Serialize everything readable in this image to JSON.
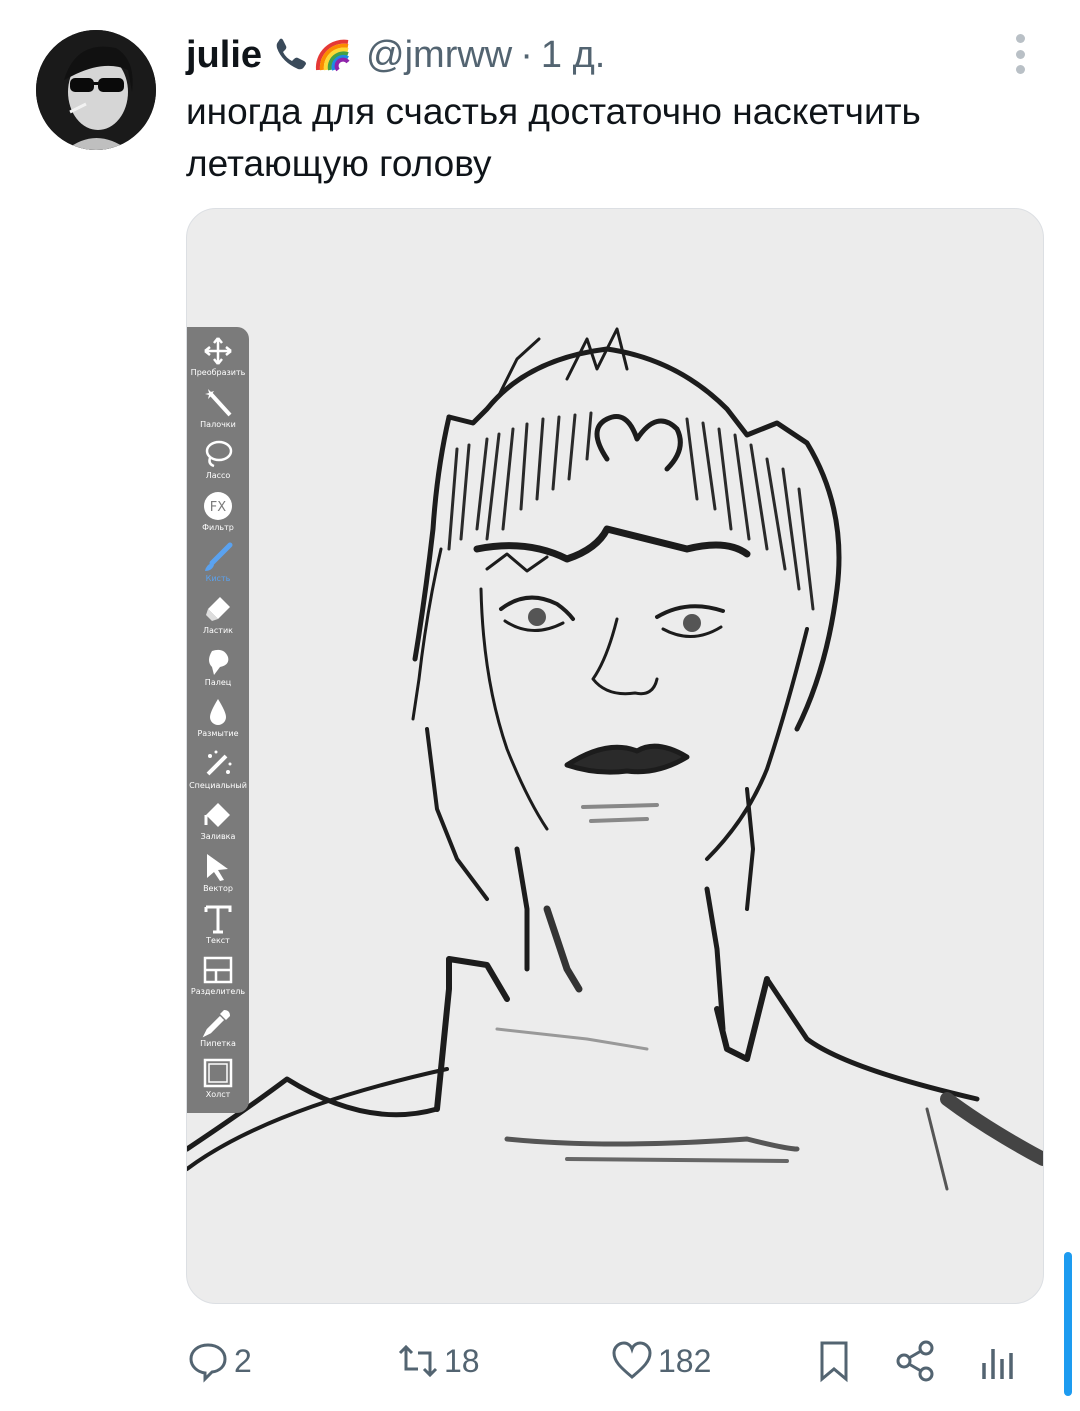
{
  "tweet": {
    "author_name": "julie",
    "author_emoji": [
      "telephone-receiver-icon",
      "rainbow-icon"
    ],
    "handle": "@jmrww",
    "separator": "·",
    "time": "1 д.",
    "text": "иногда для счастья достаточно наскетчить летающую голову"
  },
  "media": {
    "toolbar": [
      {
        "label": "Преобразить",
        "icon": "move-arrows-icon"
      },
      {
        "label": "Палочки",
        "icon": "magic-wand-icon"
      },
      {
        "label": "Лассо",
        "icon": "lasso-icon"
      },
      {
        "label": "Фильтр",
        "icon": "fx-filter-icon"
      },
      {
        "label": "Кисть",
        "icon": "brush-icon",
        "active": true
      },
      {
        "label": "Ластик",
        "icon": "eraser-icon"
      },
      {
        "label": "Палец",
        "icon": "smudge-icon"
      },
      {
        "label": "Размытие",
        "icon": "blur-drop-icon"
      },
      {
        "label": "Специальный",
        "icon": "special-wand-icon"
      },
      {
        "label": "Заливка",
        "icon": "fill-bucket-icon"
      },
      {
        "label": "Вектор",
        "icon": "vector-cursor-icon"
      },
      {
        "label": "Текст",
        "icon": "text-t-icon"
      },
      {
        "label": "Разделитель",
        "icon": "divider-icon"
      },
      {
        "label": "Пипетка",
        "icon": "eyedropper-icon"
      },
      {
        "label": "Холст",
        "icon": "canvas-icon"
      }
    ],
    "active_color": "#5aa2f0"
  },
  "actions": {
    "replies": "2",
    "retweets": "18",
    "likes": "182"
  },
  "colors": {
    "muted": "#536471",
    "accent": "#1d9bf0",
    "toolbar_bg": "#7b7b7b"
  }
}
